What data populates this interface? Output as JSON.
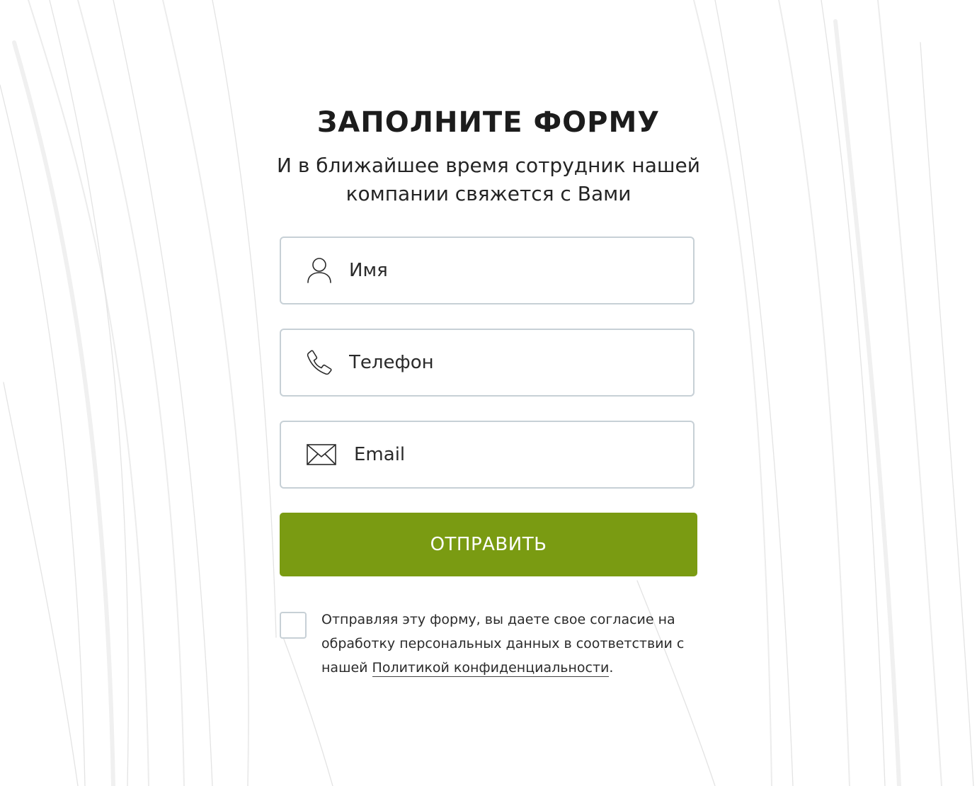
{
  "form": {
    "title": "ЗАПОЛНИТЕ ФОРМУ",
    "subtitle_line1": "И в ближайшее время сотрудник нашей",
    "subtitle_line2": "компании свяжется с Вами",
    "fields": {
      "name_placeholder": "Имя",
      "phone_placeholder": "Телефон",
      "email_placeholder": "Email"
    },
    "submit_label": "ОТПРАВИТЬ",
    "consent": {
      "text_before_link": "Отправляя эту форму, вы даете свое согласие на обработку персональных данных в соответствии с нашей ",
      "link_text": "Политикой конфиденциальности",
      "text_after_link": ".",
      "checked": false
    }
  },
  "colors": {
    "accent": "#7a9b12",
    "field_border": "#c7d0d6",
    "text": "#1f1f1f"
  },
  "icons": {
    "name": "user-icon",
    "phone": "phone-icon",
    "email": "envelope-icon"
  }
}
